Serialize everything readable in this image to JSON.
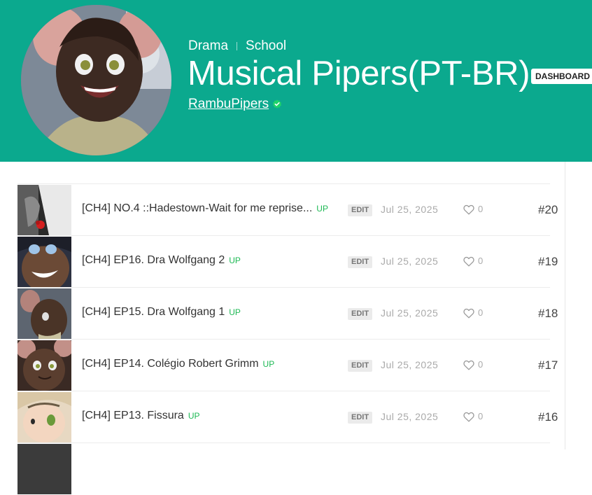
{
  "header": {
    "genres": [
      "Drama",
      "School"
    ],
    "title": "Musical Pipers(PT-BR)",
    "dashboard_label": "DASHBOARD",
    "author": "RambuPipers",
    "accent_color": "#0ba98e",
    "verified_icon": "verified-check-icon"
  },
  "episodes": [
    {
      "title": "[CH4] NO.4 ::Hadestown-Wait for me reprise...",
      "badge": "UP",
      "edit_label": "EDIT",
      "date": "Jul 25, 2025",
      "likes": "0",
      "number": "#20"
    },
    {
      "title": "[CH4] EP16. Dra Wolfgang 2",
      "badge": "UP",
      "edit_label": "EDIT",
      "date": "Jul 25, 2025",
      "likes": "0",
      "number": "#19"
    },
    {
      "title": "[CH4] EP15. Dra Wolfgang 1",
      "badge": "UP",
      "edit_label": "EDIT",
      "date": "Jul 25, 2025",
      "likes": "0",
      "number": "#18"
    },
    {
      "title": "[CH4] EP14. Colégio Robert Grimm",
      "badge": "UP",
      "edit_label": "EDIT",
      "date": "Jul 25, 2025",
      "likes": "0",
      "number": "#17"
    },
    {
      "title": "[CH4] EP13. Fissura",
      "badge": "UP",
      "edit_label": "EDIT",
      "date": "Jul 25, 2025",
      "likes": "0",
      "number": "#16"
    }
  ],
  "icons": {
    "like": "heart-outline-icon"
  }
}
